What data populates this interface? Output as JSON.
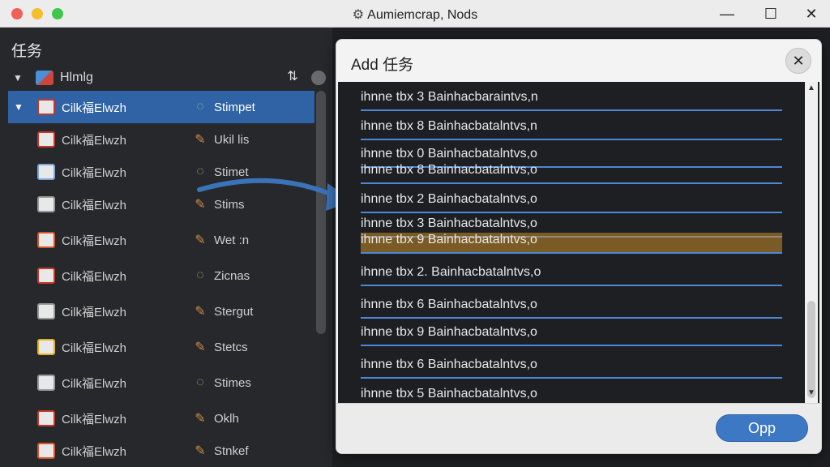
{
  "window": {
    "title": "Aumiemcrap, Nods",
    "app_icon": "bolt-icon",
    "controls": [
      "minimize-icon",
      "maximize-icon",
      "close-icon"
    ]
  },
  "left_panel": {
    "heading": "任务",
    "group": {
      "label": "Hlmlg",
      "expanded": true
    },
    "items": [
      {
        "label": "Cilk福Elwzh",
        "status": "Stimpet",
        "status_icon": "spinner-icon",
        "selected": true,
        "icon_color": "#c0392b"
      },
      {
        "label": "Cilk福Elwzh",
        "status": "Ukil lis",
        "status_icon": "wrench-icon",
        "selected": false,
        "icon_color": "#c0392b"
      },
      {
        "label": "Cilk福Elwzh",
        "status": "Stimet",
        "status_icon": "spinner-icon",
        "selected": false,
        "icon_color": "#7aa7d8"
      },
      {
        "label": "Cilk福Elwzh",
        "status": "Stims",
        "status_icon": "wrench-icon",
        "selected": false,
        "icon_color": "#9a9a9a"
      },
      {
        "label": "Cilk福Elwzh",
        "status": "Wet :n",
        "status_icon": "wrench-icon",
        "selected": false,
        "icon_color": "#d3562b"
      },
      {
        "label": "Cilk福Elwzh",
        "status": "Zicnas",
        "status_icon": "spinner-icon",
        "selected": false,
        "icon_color": "#c0392b"
      },
      {
        "label": "Cilk福Elwzh",
        "status": "Stergut",
        "status_icon": "wrench-icon",
        "selected": false,
        "icon_color": "#9a9a9a"
      },
      {
        "label": "Cilk福Elwzh",
        "status": "Stetcs",
        "status_icon": "wrench-icon",
        "selected": false,
        "icon_color": "#e0b020"
      },
      {
        "label": "Cilk福Elwzh",
        "status": "Stimes",
        "status_icon": "spinner-icon",
        "selected": false,
        "icon_color": "#9a9a9a"
      },
      {
        "label": "Cilk福Elwzh",
        "status": "Oklh",
        "status_icon": "wrench-icon",
        "selected": false,
        "icon_color": "#c0392b"
      },
      {
        "label": "Cilk福Elwzh",
        "status": "Stnkef",
        "status_icon": "wrench-icon",
        "selected": false,
        "icon_color": "#d3562b"
      }
    ]
  },
  "dialog": {
    "title": "Add 任务",
    "items": [
      "ihnne tbx 3  Bainhacbaraintvs,n",
      "ihnne tbx 8  Bainhacbatalntvs,n",
      "ihnne tbx 0  Bainhacbatalntvs,o",
      "ihnne tbx 8  Bainhacbatalntvs,o",
      "ihnne tbx 2  Bainhacbatalntvs,o",
      "ihnne tbx 3  Bainhacbatalntvs,o",
      "ihnne tbx 9  Bainhacbatalntvs,o",
      "ihnne tbx 2. Bainhacbatalntvs,o",
      "ihnne tbx 6  Bainhacbatalntvs,o",
      "ihnne tbx 9  Bainhacbatalntvs,o",
      "ihnne tbx 6  Bainhacbatalntvs,o",
      "ihnne tbx 5  Bainhacbatalntvs,o"
    ],
    "highlighted_index": 6,
    "ok_label": "Opp"
  },
  "colors": {
    "accent": "#2f63a6",
    "dialog_bg": "#f3f3f3",
    "list_bg": "#1d1f23",
    "highlight": "#c98c28",
    "button": "#3d78c4"
  }
}
